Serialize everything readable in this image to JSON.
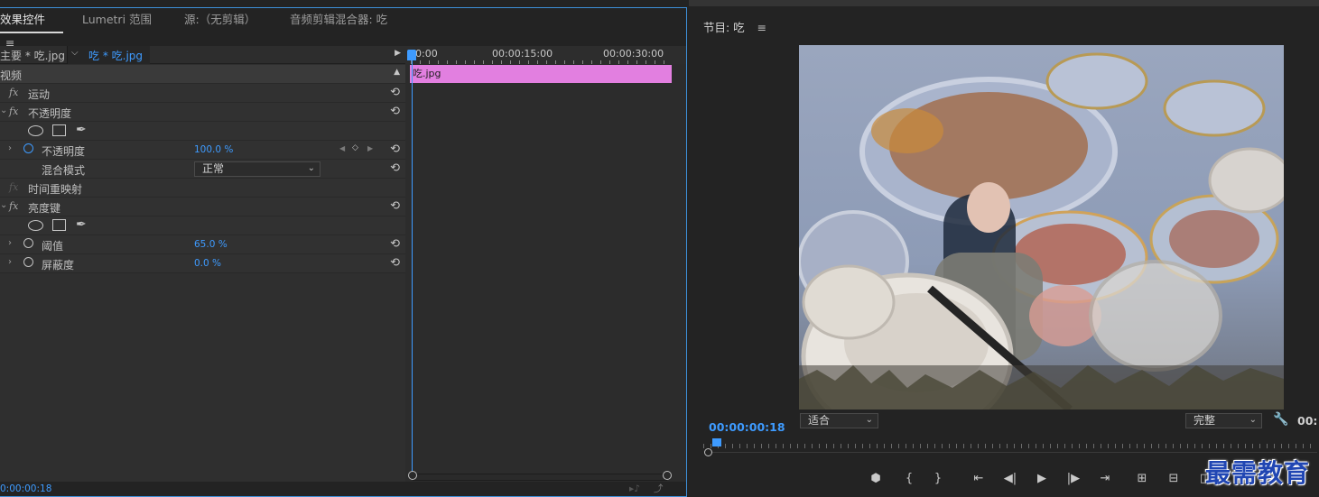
{
  "tabs": [
    {
      "label": "效果控件",
      "active": true
    },
    {
      "label": "Lumetri 范围",
      "active": false
    },
    {
      "label": "源:（无剪辑）",
      "active": false
    },
    {
      "label": "音频剪辑混合器: 吃",
      "active": false
    }
  ],
  "clip_header": {
    "master": "主要 * 吃.jpg",
    "sequence": "吃 * 吃.jpg"
  },
  "timeline": {
    "ticks": [
      "0:00",
      "00:00:15:00",
      "00:00:30:00"
    ],
    "clip_name": "吃.jpg"
  },
  "effects": {
    "section": "视频",
    "motion": "运动",
    "opacity_group": "不透明度",
    "opacity_prop": "不透明度",
    "opacity_value": "100.0 %",
    "blend_label": "混合模式",
    "blend_value": "正常",
    "time_remap": "时间重映射",
    "luma_key": "亮度键",
    "threshold_label": "阈值",
    "threshold_value": "65.0 %",
    "cutoff_label": "屏蔽度",
    "cutoff_value": "0.0 %"
  },
  "status": {
    "timecode": "0:00:00:18"
  },
  "monitor": {
    "title": "节目: 吃",
    "timecode": "00:00:00:18",
    "fit": "适合",
    "quality": "完整",
    "end_tc": "00:"
  },
  "watermark": "最需教育",
  "colors": {
    "accent": "#3e9bff",
    "clip": "#e27fe0"
  }
}
